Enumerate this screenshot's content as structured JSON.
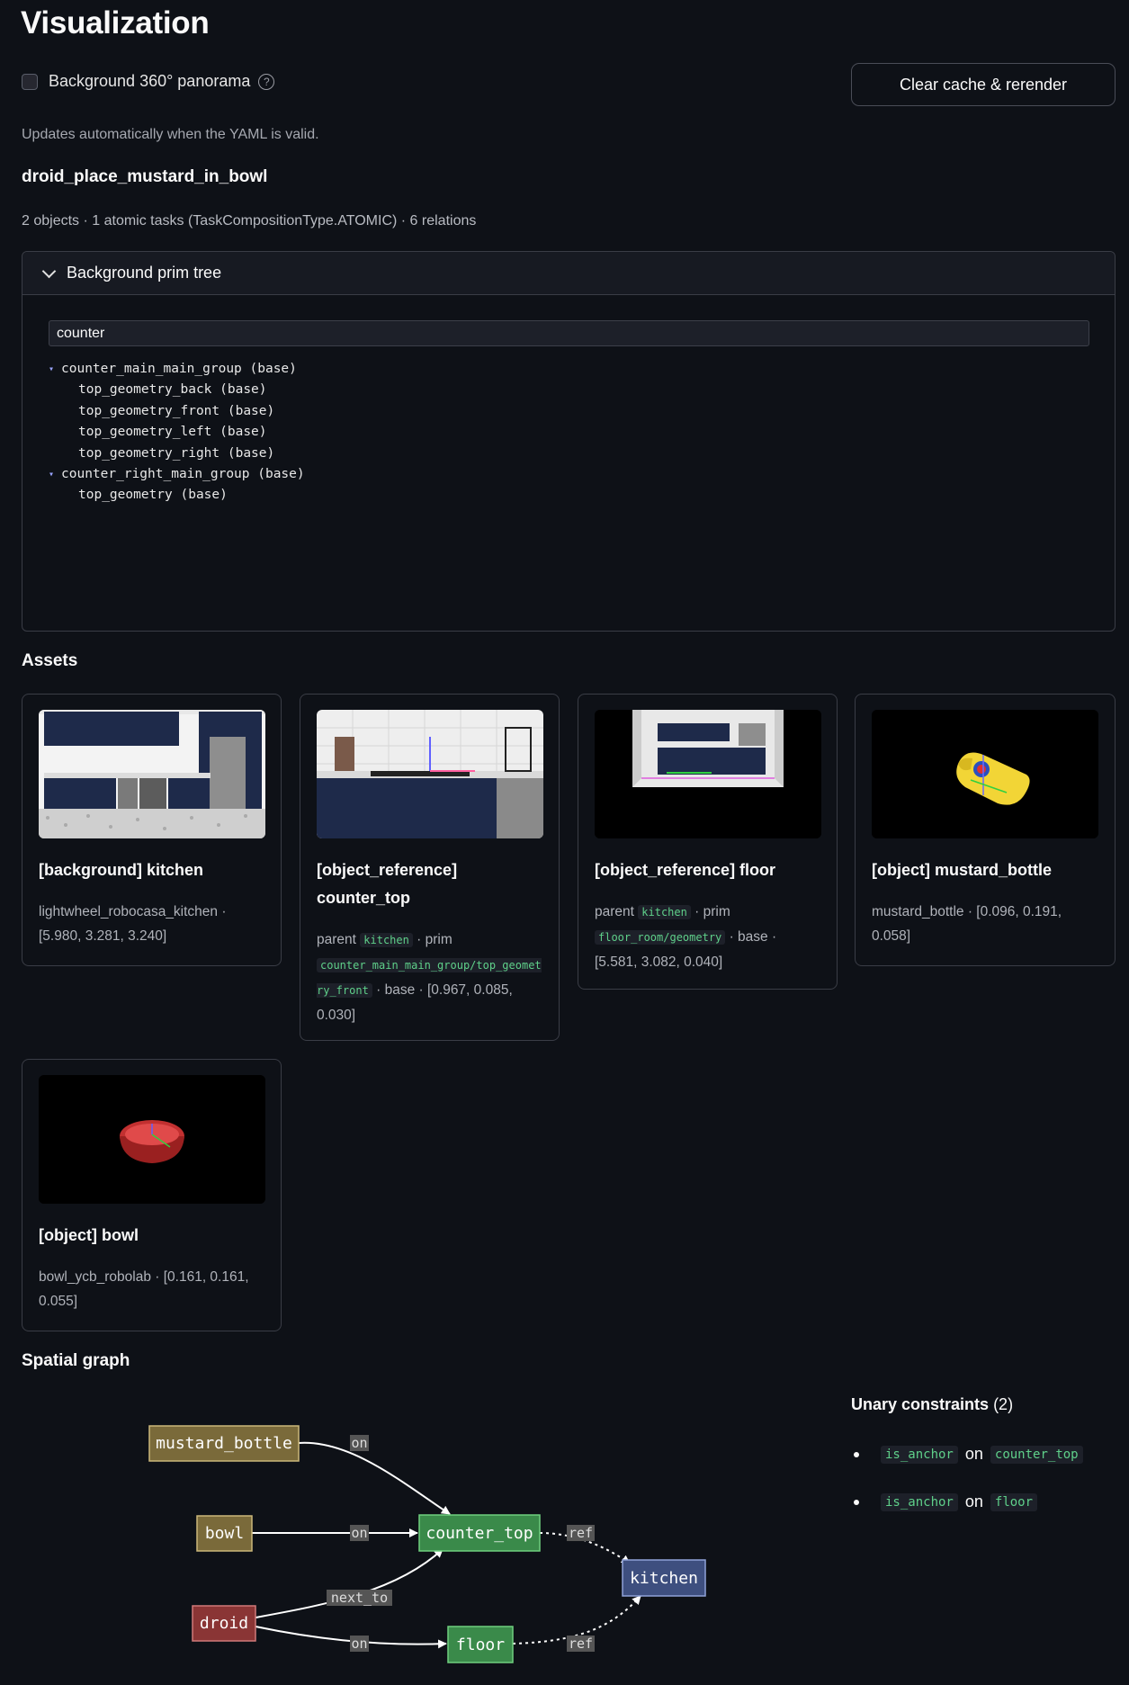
{
  "page": {
    "title": "Visualization",
    "panorama_checkbox_label": "Background 360° panorama",
    "help_glyph": "?",
    "clear_button_label": "Clear cache & rerender",
    "auto_update_caption": "Updates automatically when the YAML is valid.",
    "task_name": "droid_place_mustard_in_bowl",
    "task_summary": "2 objects · 1 atomic tasks (TaskCompositionType.ATOMIC) · 6 relations"
  },
  "prim_tree": {
    "expander_label": "Background prim tree",
    "filter_value": "counter",
    "nodes": [
      {
        "label": "counter_main_main_group (base)",
        "level": 0,
        "expanded": true
      },
      {
        "label": "top_geometry_back (base)",
        "level": 1
      },
      {
        "label": "top_geometry_front (base)",
        "level": 1
      },
      {
        "label": "top_geometry_left (base)",
        "level": 1
      },
      {
        "label": "top_geometry_right (base)",
        "level": 1
      },
      {
        "label": "counter_right_main_group (base)",
        "level": 0,
        "expanded": true
      },
      {
        "label": "top_geometry (base)",
        "level": 1
      }
    ]
  },
  "assets": {
    "heading": "Assets",
    "cards": [
      {
        "title": "[background] kitchen",
        "meta": "lightwheel_robocasa_kitchen · [5.980, 3.281, 3.240]"
      },
      {
        "title_line1": "[object_reference]",
        "title_line2": "counter_top",
        "meta_prefix": "parent",
        "parent": "kitchen",
        "meta_mid": "· prim",
        "prim": "counter_main_main_group/top_geometry_front",
        "meta_suffix": "· base · [0.967, 0.085, 0.030]"
      },
      {
        "title": "[object_reference] floor",
        "meta_prefix": "parent",
        "parent": "kitchen",
        "meta_mid": "· prim",
        "prim": "floor_room/geometry",
        "meta_suffix": "· base · [5.581, 3.082, 0.040]"
      },
      {
        "title": "[object] mustard_bottle",
        "meta": "mustard_bottle · [0.096, 0.191, 0.058]"
      },
      {
        "title": "[object] bowl",
        "meta": "bowl_ycb_robolab · [0.161, 0.161, 0.055]"
      }
    ]
  },
  "spatial_graph": {
    "heading": "Spatial graph",
    "nodes": {
      "mustard_bottle": "mustard_bottle",
      "bowl": "bowl",
      "droid": "droid",
      "counter_top": "counter_top",
      "kitchen": "kitchen",
      "floor": "floor"
    },
    "edge_labels": {
      "mustard_on": "on",
      "bowl_on": "on",
      "droid_next_to": "next_to",
      "droid_on": "on",
      "counter_ref": "ref",
      "floor_ref": "ref"
    },
    "colors": {
      "object": "#7a6a3a",
      "robot": "#8a3535",
      "reference": "#3a8a4a",
      "background": "#3e4f7f"
    }
  },
  "unary_constraints": {
    "title": "Unary constraints",
    "count": "(2)",
    "items": [
      {
        "constraint": "is_anchor",
        "joiner": "on",
        "target": "counter_top"
      },
      {
        "constraint": "is_anchor",
        "joiner": "on",
        "target": "floor"
      }
    ]
  }
}
